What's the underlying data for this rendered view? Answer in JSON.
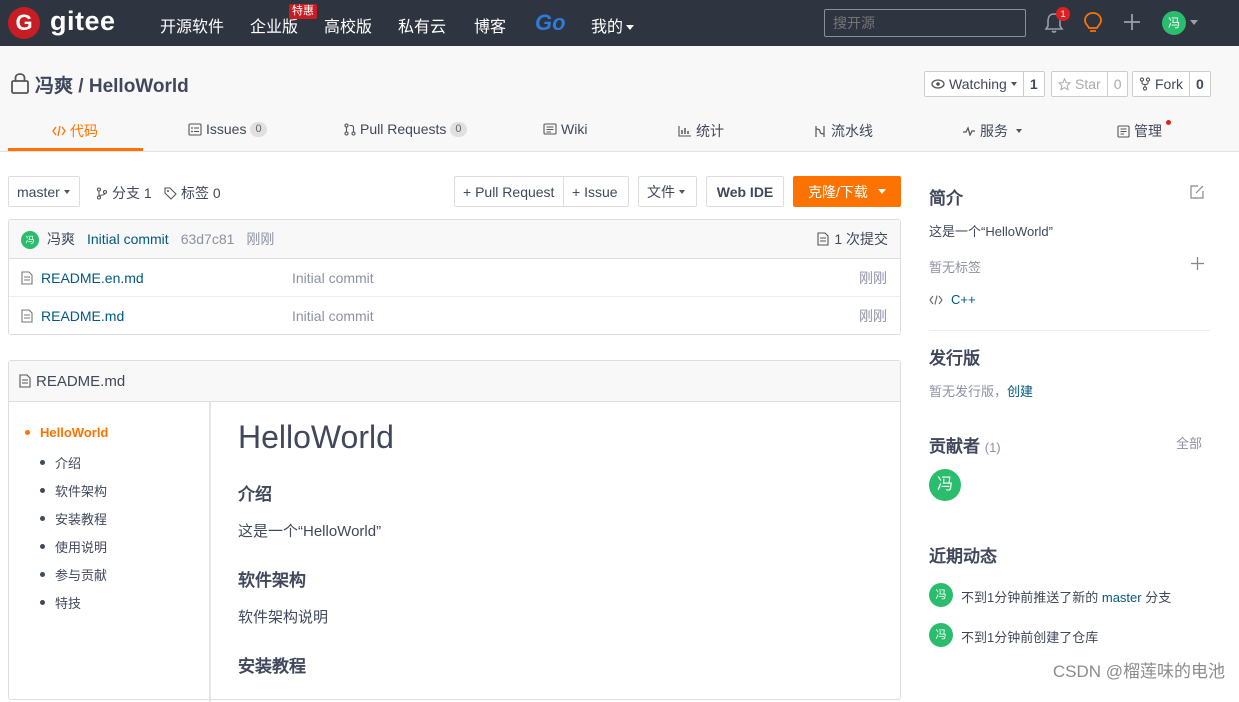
{
  "topnav": {
    "logo_letter": "G",
    "logo_text": "gitee",
    "items": [
      "开源软件",
      "企业版",
      "高校版",
      "私有云",
      "博客"
    ],
    "hot_badge": "特惠",
    "go_label": "Go",
    "mine_label": "我的",
    "search_placeholder": "搜开源",
    "notification_count": "1",
    "avatar_char": "冯"
  },
  "repo": {
    "owner": "冯爽",
    "separator": "/",
    "name": "HelloWorld",
    "watch_label": "Watching",
    "watch_count": "1",
    "star_label": "Star",
    "star_count": "0",
    "fork_label": "Fork",
    "fork_count": "0"
  },
  "tabs": [
    {
      "label": "代码"
    },
    {
      "label": "Issues",
      "count": "0"
    },
    {
      "label": "Pull Requests",
      "count": "0"
    },
    {
      "label": "Wiki"
    },
    {
      "label": "统计"
    },
    {
      "label": "流水线"
    },
    {
      "label": "服务"
    },
    {
      "label": "管理"
    }
  ],
  "toolbar": {
    "branch": "master",
    "branches": "分支 1",
    "tags": "标签 0",
    "pr_button": "+ Pull Request",
    "issue_button": "+ Issue",
    "file_button": "文件",
    "webide_button": "Web IDE",
    "clone_button": "克隆/下载"
  },
  "commit": {
    "author_char": "冯",
    "author": "冯爽",
    "message": "Initial commit",
    "hash": "63d7c81",
    "time": "刚刚",
    "count_label": "1 次提交"
  },
  "files": [
    {
      "name": "README.en.md",
      "message": "Initial commit",
      "time": "刚刚"
    },
    {
      "name": "README.md",
      "message": "Initial commit",
      "time": "刚刚"
    }
  ],
  "readme": {
    "filename": "README.md",
    "toc": [
      "HelloWorld",
      "介绍",
      "软件架构",
      "安装教程",
      "使用说明",
      "参与贡献",
      "特技"
    ],
    "title": "HelloWorld",
    "h_intro": "介绍",
    "p_intro": "这是一个“HelloWorld”",
    "h_arch": "软件架构",
    "p_arch": "软件架构说明",
    "h_install": "安装教程"
  },
  "sidebar": {
    "intro_title": "简介",
    "intro_text": "这是一个“HelloWorld”",
    "no_tags": "暂无标签",
    "language": "C++",
    "release_title": "发行版",
    "no_release": "暂无发行版，",
    "create_link": "创建",
    "contrib_title": "贡献者",
    "contrib_count": "(1)",
    "all_link": "全部",
    "contrib_char": "冯",
    "activity_title": "近期动态",
    "act1_prefix": "不到1分钟前推送了新的",
    "act1_branch": "master",
    "act1_suffix": "分支",
    "act2": "不到1分钟前创建了仓库",
    "act_char": "冯"
  },
  "watermark": "CSDN @榴莲味的电池",
  "colors": {
    "accent": "#fe7300",
    "nav_bg": "#2e3440",
    "brand": "#c71d23",
    "avatar": "#2bbd6e",
    "link": "#005980"
  }
}
